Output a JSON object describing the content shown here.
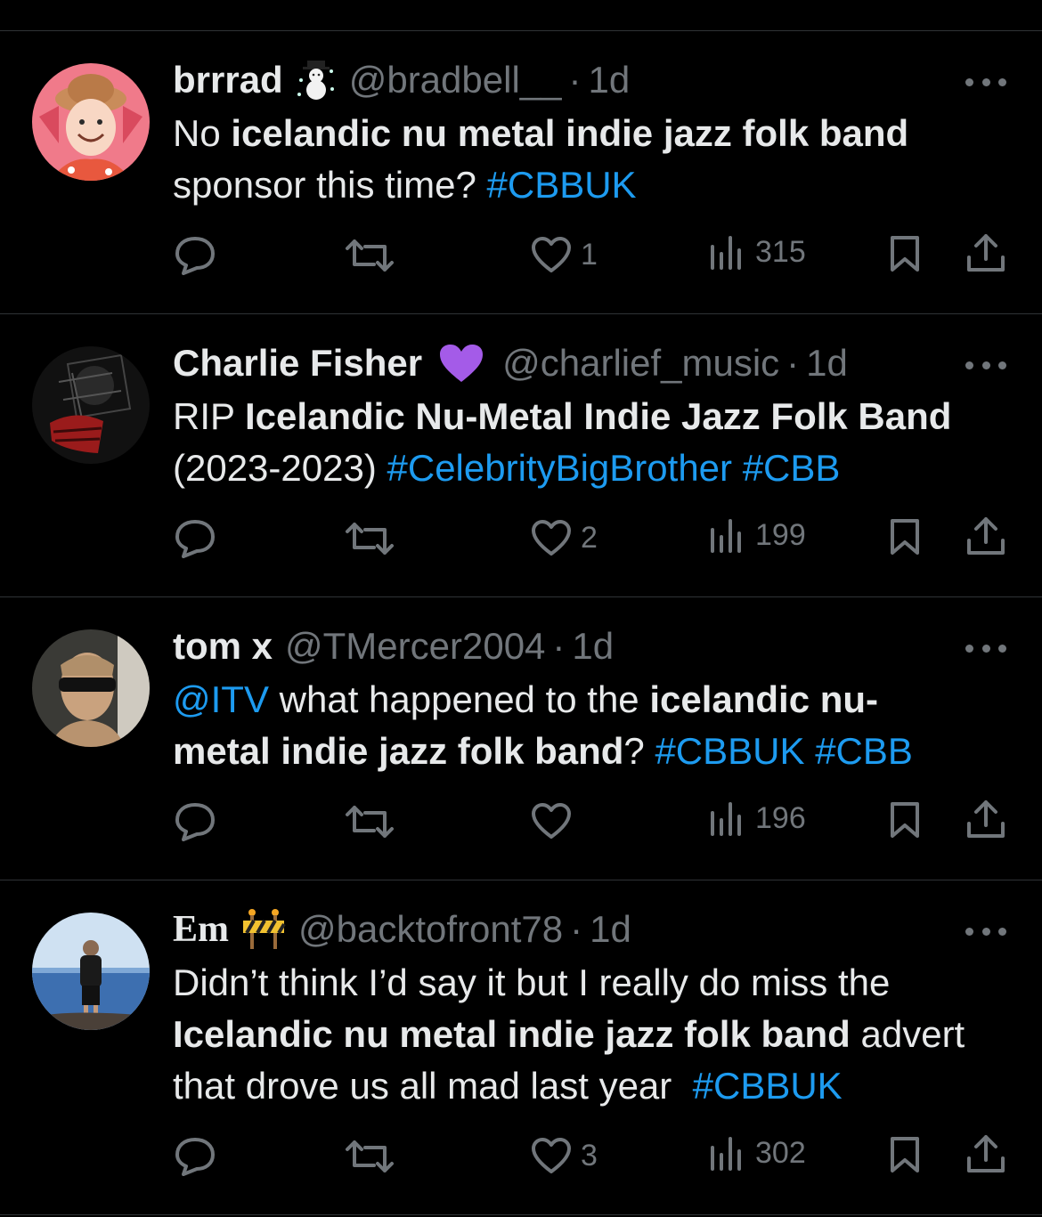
{
  "colors": {
    "background": "#000000",
    "text": "#e7e9ea",
    "muted": "#71767b",
    "link": "#1d9bf0",
    "divider": "#2f3336"
  },
  "tweets": [
    {
      "name": "brrrad",
      "badge_icon": "snowman-emoji",
      "handle": "@bradbell__",
      "separator": "·",
      "time": "1d",
      "body": {
        "l1_a": "No ",
        "l1_b": "icelandic nu metal indie jazz folk band",
        "l2_a": "sponsor this time? ",
        "l2_tag": "#CBBUK"
      },
      "likes": "1",
      "views": "315"
    },
    {
      "name": "Charlie Fisher",
      "badge_icon": "purple-heart-emoji",
      "handle": "@charlief_music",
      "separator": "·",
      "time": "1d",
      "body": {
        "l1_a": "RIP ",
        "l1_b": "Icelandic Nu-Metal Indie Jazz Folk Band",
        "l2_a": "(2023-2023) ",
        "l2_tag1": "#CelebrityBigBrother",
        "l2_tag2": "#CBB"
      },
      "likes": "2",
      "views": "199"
    },
    {
      "name": "tom x",
      "handle": "@TMercer2004",
      "separator": "·",
      "time": "1d",
      "body": {
        "l1_mention": "@ITV",
        "l1_a": " what happened to the ",
        "l1_b": "icelandic nu-",
        "l2_b": "metal indie jazz folk band",
        "l2_a": "? ",
        "l2_tag1": "#CBBUK",
        "l2_tag2": "#CBB"
      },
      "likes": "",
      "views": "196"
    },
    {
      "name": "Em",
      "badge_icon": "construction-emoji",
      "handle": "@backtofront78",
      "separator": "·",
      "time": "1d",
      "body": {
        "l1_a": "Didn’t think I’d say it but I really do miss the",
        "l2_b": "Icelandic nu metal indie jazz folk band",
        "l2_a": " advert",
        "l3_a": "that drove us all mad last year  ",
        "l3_tag": "#CBBUK"
      },
      "likes": "3",
      "views": "302"
    }
  ]
}
